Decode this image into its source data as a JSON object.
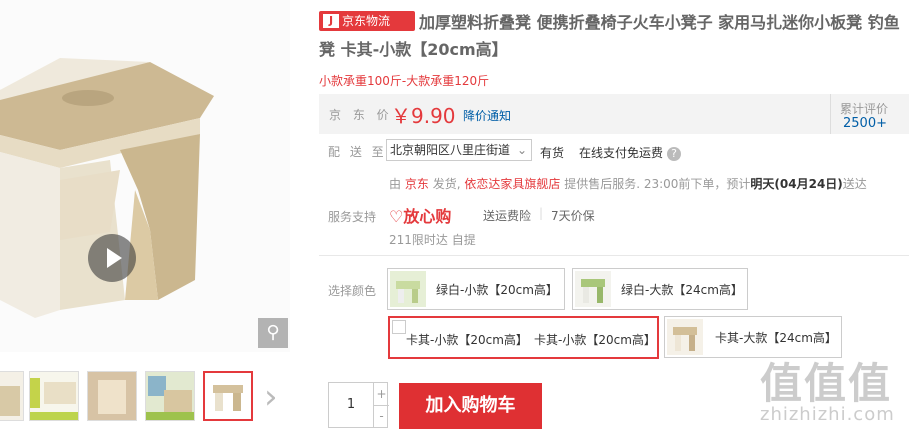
{
  "product": {
    "logo_text": "京东物流",
    "title": "加厚塑料折叠凳 便携折叠椅子火车小凳子 家用马扎迷你小板凳 钓鱼凳 卡其-小款【20cm高】",
    "promo": "小款承重100斤-大款承重120斤"
  },
  "price": {
    "label": "京 东 价",
    "value": "￥9.90",
    "notice": "降价通知",
    "review_label": "累计评价",
    "review_count": "2500+"
  },
  "delivery": {
    "label": "配 送 至",
    "address": "北京朝阳区八里庄街道",
    "stock": "有货",
    "free_ship": "在线支付免运费",
    "from_prefix": "由",
    "seller_jd": "京东",
    "ship_text": "发货,",
    "shop": "依恋达家具旗舰店",
    "service_text": "提供售后服务. 23:00前下单，预计",
    "eta": "明天(04月24日)",
    "eta_suffix": "送达"
  },
  "service": {
    "label": "服务支持",
    "badge": "放心购",
    "items": [
      "送运费险",
      "7天价保"
    ],
    "line2": "211限时达 自提"
  },
  "color": {
    "label": "选择颜色",
    "options": [
      {
        "label": "绿白-小款【20cm高】"
      },
      {
        "label": "绿白-大款【24cm高】"
      },
      {
        "label": "卡其-小款【20cm高】",
        "alt": "卡其-小款【20cm高】"
      },
      {
        "label": "卡其-大款【24cm高】"
      }
    ]
  },
  "cart": {
    "quantity": "1",
    "plus": "+",
    "minus": "-",
    "button": "加入购物车"
  },
  "watermark": {
    "big": "值值值",
    "site": "zhizhizhi.com"
  },
  "colors": {
    "accent": "#e4393c",
    "link": "#005ea7"
  }
}
